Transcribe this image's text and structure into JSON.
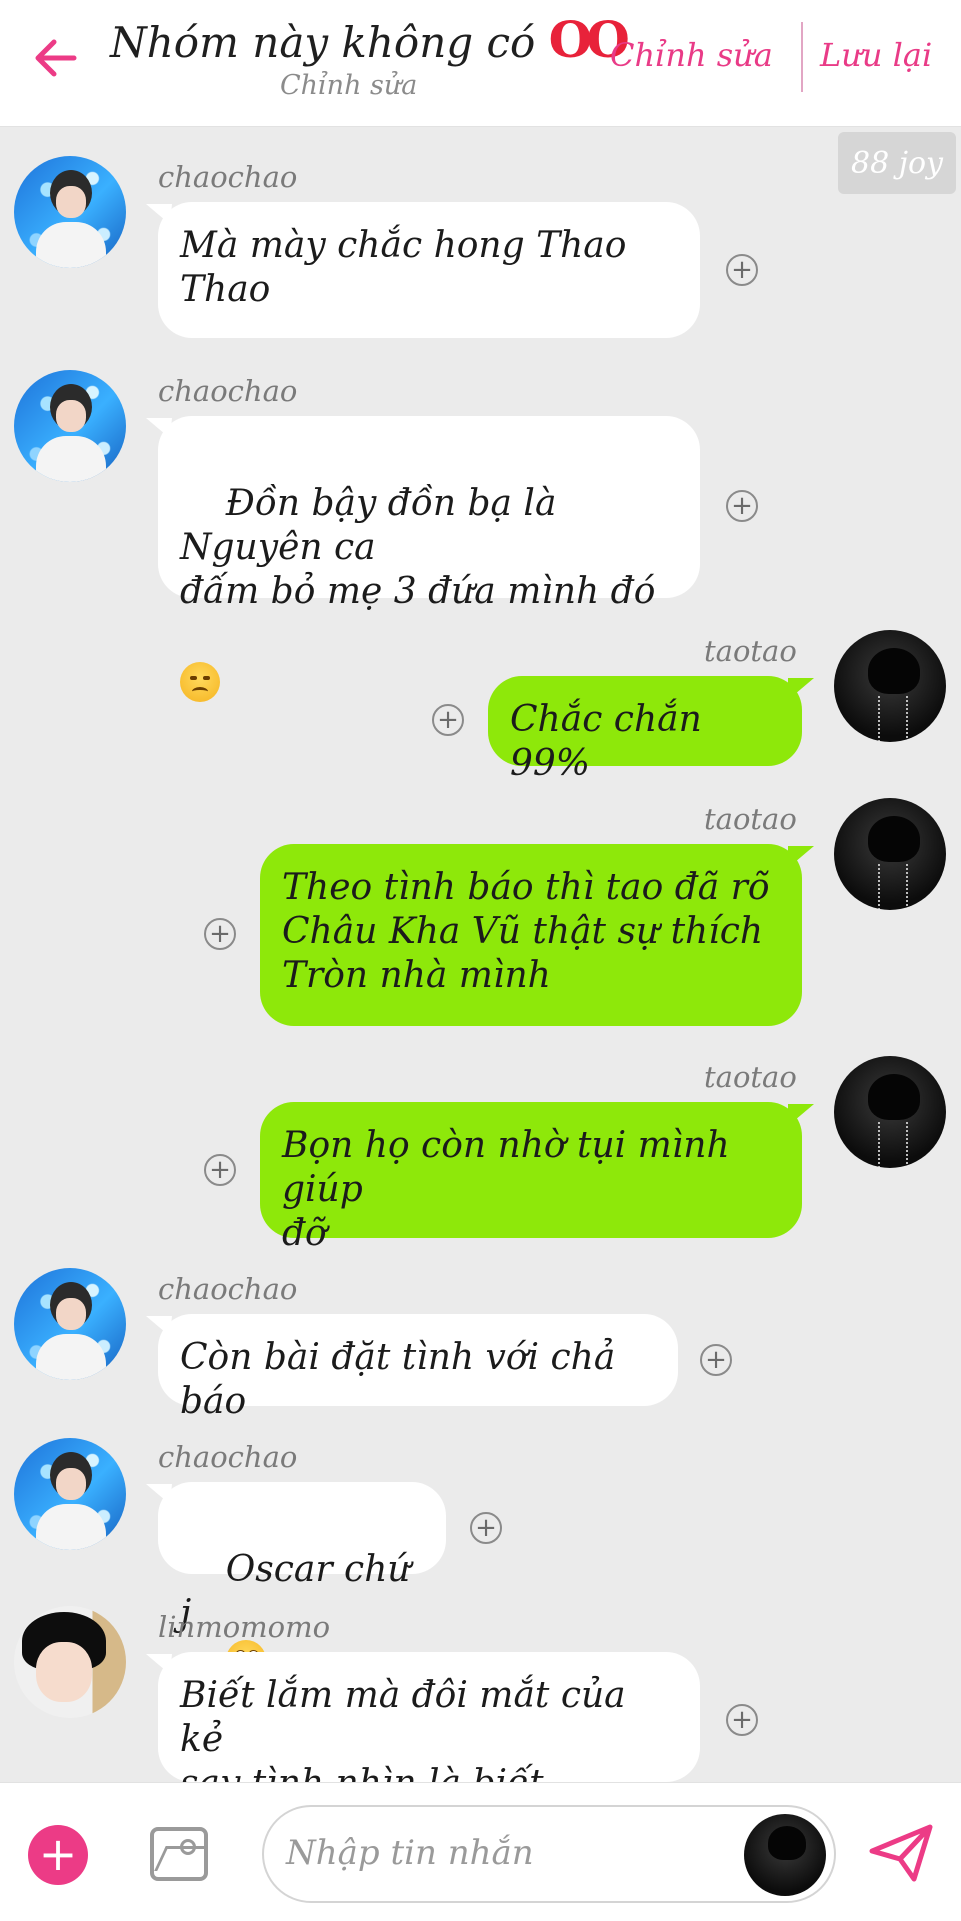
{
  "header": {
    "title": "Nhóm này không có",
    "title_rings": "OO",
    "subtitle": "Chỉnh sửa",
    "edit_label": "Chỉnh sửa",
    "save_label": "Lưu lại"
  },
  "watermark": "88 joy",
  "messages": [
    {
      "sender": "chaochao",
      "text": "Mà mày chắc hong Thao\nThao"
    },
    {
      "sender": "chaochao",
      "text": "Đồn bậy đồn bạ là Nguyên ca\nđấm bỏ mẹ 3 đứa mình đó"
    },
    {
      "sender": "taotao",
      "text": "Chắc chắn 99%"
    },
    {
      "sender": "taotao",
      "text": "Theo tình báo thì tao đã rõ\nChâu Kha Vũ thật sự thích\nTròn nhà mình"
    },
    {
      "sender": "taotao",
      "text": "Bọn họ còn nhờ tụi mình giúp\nđỡ"
    },
    {
      "sender": "chaochao",
      "text": "Còn bài đặt tình với chả báo"
    },
    {
      "sender": "chaochao",
      "text": "Oscar chứ j"
    },
    {
      "sender": "linmomomo",
      "text": "Biết lắm mà đôi mắt của kẻ\nsay tình nhìn là biết"
    }
  ],
  "footer": {
    "input_placeholder": "Nhập tin nhắn"
  },
  "icons": {
    "back": "arrow-left-icon",
    "add": "plus-icon",
    "image": "image-icon",
    "send": "paper-plane-icon",
    "react": "plus-circle-icon"
  },
  "colors": {
    "accent": "#e93b87",
    "outgoing_bubble": "#8ee80a",
    "incoming_bubble": "#ffffff",
    "background": "#ebebeb"
  }
}
